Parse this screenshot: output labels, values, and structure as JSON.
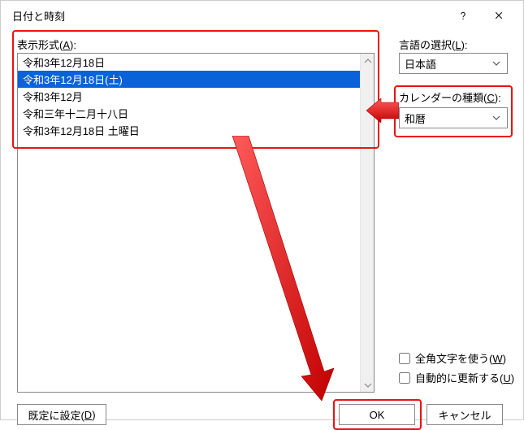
{
  "dialog": {
    "title": "日付と時刻"
  },
  "labels": {
    "format": "表示形式(",
    "format_u": "A",
    "format_tail": "):",
    "language": "言語の選択(",
    "language_u": "L",
    "language_tail": "):",
    "calendar": "カレンダーの種類(",
    "calendar_u": "C",
    "calendar_tail": "):"
  },
  "formats": {
    "items": [
      "令和3年12月18日",
      "令和3年12月18日(土)",
      "令和3年12月",
      "令和三年十二月十八日",
      "令和3年12月18日 土曜日"
    ],
    "selectedIndex": 1
  },
  "language": {
    "value": "日本語"
  },
  "calendar": {
    "value": "和暦"
  },
  "checks": {
    "fullwidth": "全角文字を使う(",
    "fullwidth_u": "W",
    "fullwidth_tail": ")",
    "autoupdate": "自動的に更新する(",
    "autoupdate_u": "U",
    "autoupdate_tail": ")"
  },
  "buttons": {
    "default": "既定に設定(",
    "default_u": "D",
    "default_tail": ")",
    "ok": "OK",
    "cancel": "キャンセル"
  }
}
